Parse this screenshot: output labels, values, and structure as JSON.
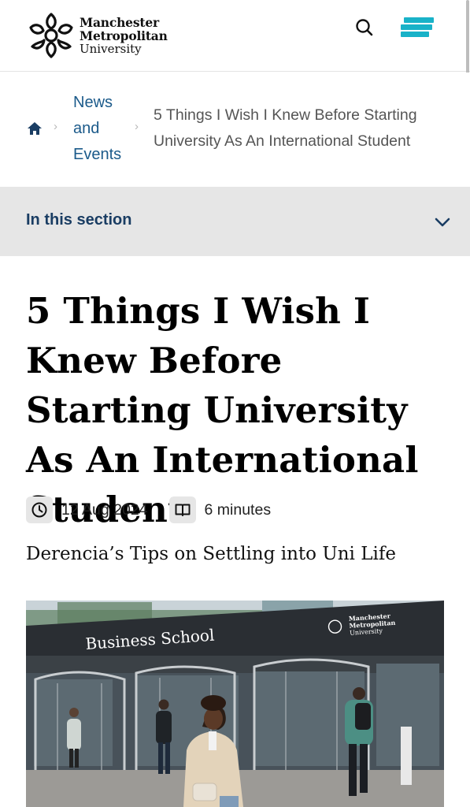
{
  "header": {
    "logo": {
      "line1": "Manchester",
      "line2": "Metropolitan",
      "line3": "University"
    },
    "search_icon": "search-icon",
    "menu_icon": "hamburger-menu-icon",
    "menu_color": "#19b2c8"
  },
  "breadcrumb": {
    "home_icon": "home-icon",
    "link_label": "News and Events",
    "current": "5 Things I Wish I Knew Before Starting University As An International Student"
  },
  "section_nav": {
    "label": "In this section",
    "icon": "chevron-down-icon"
  },
  "article": {
    "title": "5 Things I Wish I Knew Before Starting University As An International Student",
    "date": "12 Aug 2024",
    "date_icon": "clock-icon",
    "read_time": "6 minutes",
    "read_time_icon": "book-icon",
    "subtitle": "Derencia’s Tips on Settling into Uni Life",
    "hero": {
      "sign_text": "Business School",
      "sign_logo": {
        "line1": "Manchester",
        "line2": "Metropolitan",
        "line3": "University"
      }
    }
  },
  "colors": {
    "link": "#1b5a8a",
    "section_label": "#1a3d63",
    "section_bg": "#e6e6e6",
    "accent": "#19b2c8"
  }
}
